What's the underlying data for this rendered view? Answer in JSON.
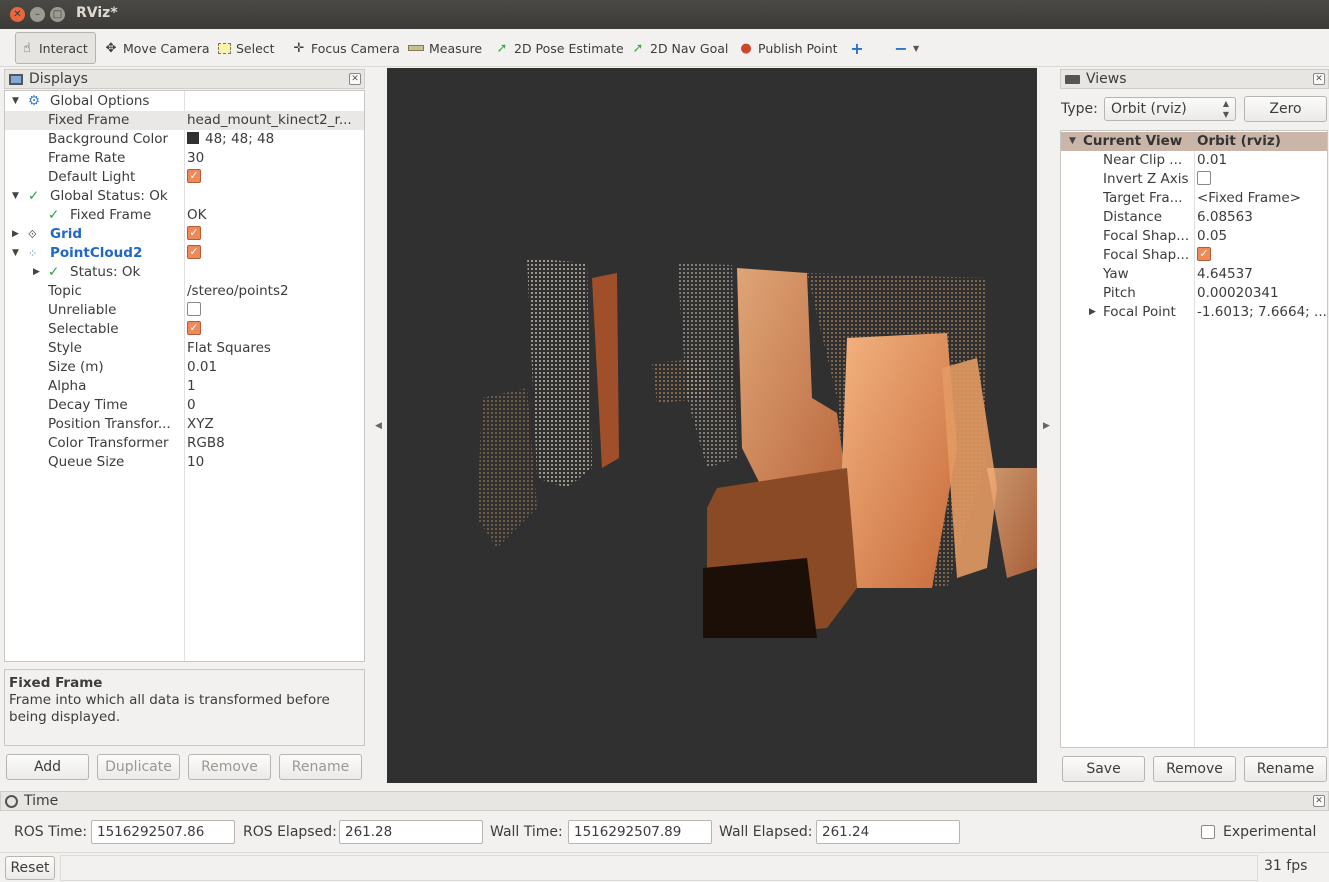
{
  "window": {
    "title": "RViz*"
  },
  "toolbar": {
    "interact": "Interact",
    "move_camera": "Move Camera",
    "select": "Select",
    "focus_camera": "Focus Camera",
    "measure": "Measure",
    "pose_estimate": "2D Pose Estimate",
    "nav_goal": "2D Nav Goal",
    "publish_point": "Publish Point"
  },
  "displays": {
    "title": "Displays",
    "rows": [
      {
        "name": "Global Options",
        "value": ""
      },
      {
        "name": "Fixed Frame",
        "value": "head_mount_kinect2_r..."
      },
      {
        "name": "Background Color",
        "value": "48; 48; 48"
      },
      {
        "name": "Frame Rate",
        "value": "30"
      },
      {
        "name": "Default Light",
        "value": ""
      },
      {
        "name": "Global Status: Ok",
        "value": ""
      },
      {
        "name": "Fixed Frame",
        "value": "OK"
      },
      {
        "name": "Grid",
        "value": ""
      },
      {
        "name": "PointCloud2",
        "value": ""
      },
      {
        "name": "Status: Ok",
        "value": ""
      },
      {
        "name": "Topic",
        "value": "/stereo/points2"
      },
      {
        "name": "Unreliable",
        "value": ""
      },
      {
        "name": "Selectable",
        "value": ""
      },
      {
        "name": "Style",
        "value": "Flat Squares"
      },
      {
        "name": "Size (m)",
        "value": "0.01"
      },
      {
        "name": "Alpha",
        "value": "1"
      },
      {
        "name": "Decay Time",
        "value": "0"
      },
      {
        "name": "Position Transfor...",
        "value": "XYZ"
      },
      {
        "name": "Color Transformer",
        "value": "RGB8"
      },
      {
        "name": "Queue Size",
        "value": "10"
      }
    ],
    "description": {
      "title": "Fixed Frame",
      "text": "Frame into which all data is transformed before being displayed."
    },
    "buttons": {
      "add": "Add",
      "duplicate": "Duplicate",
      "remove": "Remove",
      "rename": "Rename"
    }
  },
  "views": {
    "title": "Views",
    "type_label": "Type:",
    "type_value": "Orbit (rviz)",
    "zero": "Zero",
    "rows": [
      {
        "name": "Current View",
        "value": "Orbit (rviz)"
      },
      {
        "name": "Near Clip ...",
        "value": "0.01"
      },
      {
        "name": "Invert Z Axis",
        "value": ""
      },
      {
        "name": "Target Fra...",
        "value": "<Fixed Frame>"
      },
      {
        "name": "Distance",
        "value": "6.08563"
      },
      {
        "name": "Focal Shap...",
        "value": "0.05"
      },
      {
        "name": "Focal Shap...",
        "value": ""
      },
      {
        "name": "Yaw",
        "value": "4.64537"
      },
      {
        "name": "Pitch",
        "value": "0.00020341"
      },
      {
        "name": "Focal Point",
        "value": "-1.6013; 7.6664; ..."
      }
    ],
    "buttons": {
      "save": "Save",
      "remove": "Remove",
      "rename": "Rename"
    }
  },
  "time": {
    "title": "Time",
    "ros_time_label": "ROS Time:",
    "ros_time": "1516292507.86",
    "ros_elapsed_label": "ROS Elapsed:",
    "ros_elapsed": "261.28",
    "wall_time_label": "Wall Time:",
    "wall_time": "1516292507.89",
    "wall_elapsed_label": "Wall Elapsed:",
    "wall_elapsed": "261.24",
    "experimental": "Experimental"
  },
  "status": {
    "reset": "Reset",
    "fps": "31 fps"
  }
}
